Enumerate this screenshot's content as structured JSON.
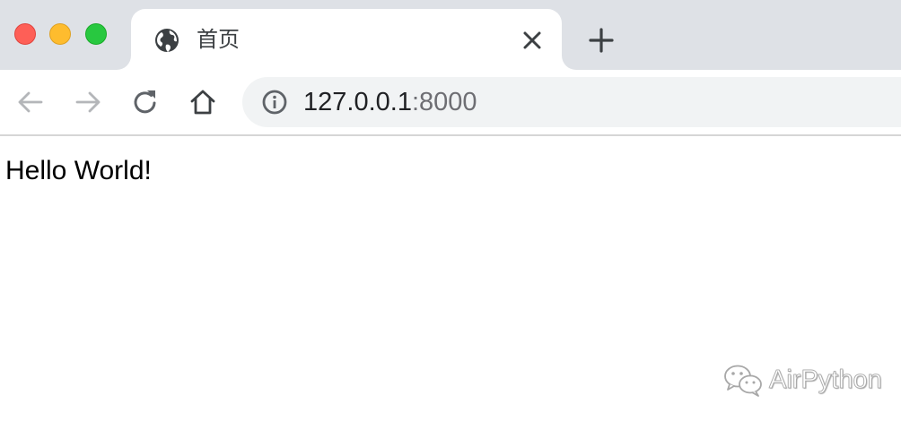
{
  "window": {
    "traffic_lights": {
      "close_color": "#fe5f57",
      "minimize_color": "#febc2e",
      "maximize_color": "#28c840"
    }
  },
  "tab": {
    "title": "首页",
    "favicon": "globe-icon",
    "close_icon": "close-icon"
  },
  "new_tab_icon": "plus-icon",
  "toolbar": {
    "back_icon": "arrow-left-icon",
    "forward_icon": "arrow-right-icon",
    "reload_icon": "reload-icon",
    "home_icon": "home-icon"
  },
  "address_bar": {
    "security_icon": "info-icon",
    "host": "127.0.0.1",
    "port": ":8000"
  },
  "page": {
    "body_text": "Hello World!"
  },
  "watermark": {
    "icon": "wechat-icon",
    "text": "AirPython"
  }
}
